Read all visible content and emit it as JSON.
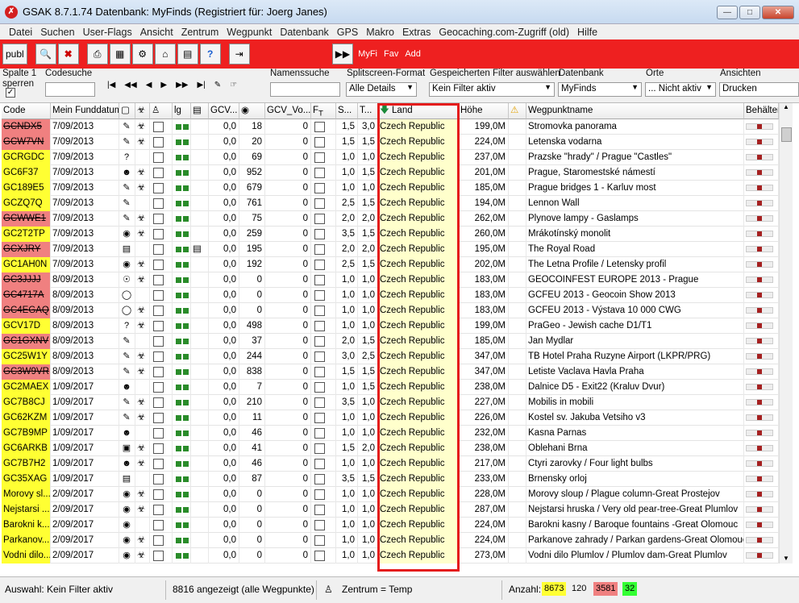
{
  "window": {
    "title": "GSAK 8.7.1.74    Datenbank: MyFinds    (Registriert für: Joerg Janes)"
  },
  "menu": [
    "Datei",
    "Suchen",
    "User-Flags",
    "Ansicht",
    "Zentrum",
    "Wegpunkt",
    "Datenbank",
    "GPS",
    "Makro",
    "Extras",
    "Geocaching.com-Zugriff (old)",
    "Hilfe"
  ],
  "toolbar": {
    "publ": "publ",
    "myfi": "MyFi",
    "fav": "Fav",
    "add": "Add"
  },
  "filterbar": {
    "spalte": "Spalte 1",
    "sperren": "sperren",
    "codesuche": "Codesuche",
    "namenssuche": "Namenssuche",
    "splitscreen_label": "Splitscreen-Format",
    "splitscreen_value": "Alle Details",
    "filter_label": "Gespeicherten Filter auswählen",
    "filter_value": "Kein Filter aktiv",
    "datenbank_label": "Datenbank",
    "datenbank_value": "MyFinds",
    "orte_label": "Orte",
    "orte_value": "... Nicht aktiv",
    "ansichten_label": "Ansichten",
    "ansichten_value": "Drucken"
  },
  "columns": [
    "Code",
    "Mein Funddatum",
    "",
    "",
    "",
    "lg",
    "",
    "GCV...",
    "",
    "GCV_Vo...",
    "",
    "S...",
    "T...",
    "Land",
    "Höhe",
    "",
    "Wegpunktname",
    "Behälter"
  ],
  "rows": [
    {
      "code": "GCNDX5",
      "cs": "r",
      "date": "7/09/2013",
      "gcv": "0,0",
      "fav": "18",
      "gcvvo": "0",
      "s": "1,5",
      "t": "3,0",
      "land": "Czech Republic",
      "hoehe": "199,0M",
      "name": "Stromovka panorama"
    },
    {
      "code": "GCW7VN",
      "cs": "r",
      "date": "7/09/2013",
      "gcv": "0,0",
      "fav": "20",
      "gcvvo": "0",
      "s": "1,5",
      "t": "1,5",
      "land": "Czech Republic",
      "hoehe": "224,0M",
      "name": "Letenska vodarna"
    },
    {
      "code": "GCRGDC",
      "cs": "y",
      "date": "7/09/2013",
      "gcv": "0,0",
      "fav": "69",
      "gcvvo": "0",
      "s": "1,0",
      "t": "1,0",
      "land": "Czech Republic",
      "hoehe": "237,0M",
      "name": "Prazske \"hrady\" / Prague \"Castles\""
    },
    {
      "code": "GC6F37",
      "cs": "y",
      "date": "7/09/2013",
      "gcv": "0,0",
      "fav": "952",
      "gcvvo": "0",
      "s": "1,0",
      "t": "1,5",
      "land": "Czech Republic",
      "hoehe": "201,0M",
      "name": "Prague, Staromestské námestí"
    },
    {
      "code": "GC189E5",
      "cs": "y",
      "date": "7/09/2013",
      "gcv": "0,0",
      "fav": "679",
      "gcvvo": "0",
      "s": "1,0",
      "t": "1,0",
      "land": "Czech Republic",
      "hoehe": "185,0M",
      "name": "Prague bridges 1 - Karluv most"
    },
    {
      "code": "GCZQ7Q",
      "cs": "y",
      "date": "7/09/2013",
      "gcv": "0,0",
      "fav": "761",
      "gcvvo": "0",
      "s": "2,5",
      "t": "1,5",
      "land": "Czech Republic",
      "hoehe": "194,0M",
      "name": "Lennon Wall"
    },
    {
      "code": "GCWWE1",
      "cs": "r",
      "date": "7/09/2013",
      "gcv": "0,0",
      "fav": "75",
      "gcvvo": "0",
      "s": "2,0",
      "t": "2,0",
      "land": "Czech Republic",
      "hoehe": "262,0M",
      "name": "Plynove lampy - Gaslamps"
    },
    {
      "code": "GC2T2TP",
      "cs": "y",
      "date": "7/09/2013",
      "gcv": "0,0",
      "fav": "259",
      "gcvvo": "0",
      "s": "3,5",
      "t": "1,5",
      "land": "Czech Republic",
      "hoehe": "260,0M",
      "name": "Mrákotínský monolit"
    },
    {
      "code": "GCXJRY",
      "cs": "r",
      "date": "7/09/2013",
      "gcv": "0,0",
      "fav": "195",
      "gcvvo": "0",
      "s": "2,0",
      "t": "2,0",
      "land": "Czech Republic",
      "hoehe": "195,0M",
      "name": "The Royal Road"
    },
    {
      "code": "GC1AH0N",
      "cs": "y",
      "date": "7/09/2013",
      "gcv": "0,0",
      "fav": "192",
      "gcvvo": "0",
      "s": "2,5",
      "t": "1,5",
      "land": "Czech Republic",
      "hoehe": "202,0M",
      "name": "The Letna Profile / Letensky profil"
    },
    {
      "code": "GC3JJJJ",
      "cs": "r",
      "date": "8/09/2013",
      "gcv": "0,0",
      "fav": "0",
      "gcvvo": "0",
      "s": "1,0",
      "t": "1,0",
      "land": "Czech Republic",
      "hoehe": "183,0M",
      "name": "GEOCOINFEST EUROPE 2013 - Prague"
    },
    {
      "code": "GC4717A",
      "cs": "r",
      "date": "8/09/2013",
      "gcv": "0,0",
      "fav": "0",
      "gcvvo": "0",
      "s": "1,0",
      "t": "1,0",
      "land": "Czech Republic",
      "hoehe": "183,0M",
      "name": "GCFEU 2013 - Geocoin Show 2013"
    },
    {
      "code": "GC4EGAQ",
      "cs": "r",
      "date": "8/09/2013",
      "gcv": "0,0",
      "fav": "0",
      "gcvvo": "0",
      "s": "1,0",
      "t": "1,0",
      "land": "Czech Republic",
      "hoehe": "183,0M",
      "name": "GCFEU 2013 - Výstava 10 000 CWG"
    },
    {
      "code": "GCV17D",
      "cs": "y",
      "date": "8/09/2013",
      "gcv": "0,0",
      "fav": "498",
      "gcvvo": "0",
      "s": "1,0",
      "t": "1,0",
      "land": "Czech Republic",
      "hoehe": "199,0M",
      "name": "PraGeo - Jewish cache D1/T1"
    },
    {
      "code": "GC1GXNV",
      "cs": "r",
      "date": "8/09/2013",
      "gcv": "0,0",
      "fav": "37",
      "gcvvo": "0",
      "s": "2,0",
      "t": "1,5",
      "land": "Czech Republic",
      "hoehe": "185,0M",
      "name": "Jan Mydlar"
    },
    {
      "code": "GC25W1Y",
      "cs": "y",
      "date": "8/09/2013",
      "gcv": "0,0",
      "fav": "244",
      "gcvvo": "0",
      "s": "3,0",
      "t": "2,5",
      "land": "Czech Republic",
      "hoehe": "347,0M",
      "name": "TB Hotel Praha Ruzyne Airport (LKPR/PRG)"
    },
    {
      "code": "GC3W9VR",
      "cs": "r",
      "date": "8/09/2013",
      "gcv": "0,0",
      "fav": "838",
      "gcvvo": "0",
      "s": "1,5",
      "t": "1,5",
      "land": "Czech Republic",
      "hoehe": "347,0M",
      "name": "Letiste Vaclava Havla Praha"
    },
    {
      "code": "GC2MAEX",
      "cs": "y",
      "date": "1/09/2017",
      "gcv": "0,0",
      "fav": "7",
      "gcvvo": "0",
      "s": "1,0",
      "t": "1,5",
      "land": "Czech Republic",
      "hoehe": "238,0M",
      "name": "Dalnice D5 - Exit22 (Kraluv Dvur)"
    },
    {
      "code": "GC7B8CJ",
      "cs": "y",
      "date": "1/09/2017",
      "gcv": "0,0",
      "fav": "210",
      "gcvvo": "0",
      "s": "3,5",
      "t": "1,0",
      "land": "Czech Republic",
      "hoehe": "227,0M",
      "name": "Mobilis in mobili"
    },
    {
      "code": "GC62KZM",
      "cs": "y",
      "date": "1/09/2017",
      "gcv": "0,0",
      "fav": "11",
      "gcvvo": "0",
      "s": "1,0",
      "t": "1,0",
      "land": "Czech Republic",
      "hoehe": "226,0M",
      "name": "Kostel sv. Jakuba Vetsiho v3"
    },
    {
      "code": "GC7B9MP",
      "cs": "y",
      "date": "1/09/2017",
      "gcv": "0,0",
      "fav": "46",
      "gcvvo": "0",
      "s": "1,0",
      "t": "1,0",
      "land": "Czech Republic",
      "hoehe": "232,0M",
      "name": "Kasna Parnas"
    },
    {
      "code": "GC6ARKB",
      "cs": "y",
      "date": "1/09/2017",
      "gcv": "0,0",
      "fav": "41",
      "gcvvo": "0",
      "s": "1,5",
      "t": "2,0",
      "land": "Czech Republic",
      "hoehe": "238,0M",
      "name": "Oblehani Brna"
    },
    {
      "code": "GC7B7H2",
      "cs": "y",
      "date": "1/09/2017",
      "gcv": "0,0",
      "fav": "46",
      "gcvvo": "0",
      "s": "1,0",
      "t": "1,0",
      "land": "Czech Republic",
      "hoehe": "217,0M",
      "name": "Ctyri zarovky / Four light bulbs"
    },
    {
      "code": "GC35XAG",
      "cs": "y",
      "date": "1/09/2017",
      "gcv": "0,0",
      "fav": "87",
      "gcvvo": "0",
      "s": "3,5",
      "t": "1,5",
      "land": "Czech Republic",
      "hoehe": "233,0M",
      "name": "Brnensky orloj"
    },
    {
      "code": "Morovy sl...",
      "cs": "y",
      "date": "2/09/2017",
      "gcv": "0,0",
      "fav": "0",
      "gcvvo": "0",
      "s": "1,0",
      "t": "1,0",
      "land": "Czech Republic",
      "hoehe": "228,0M",
      "name": "Morovy sloup / Plague column-Great Prostejov"
    },
    {
      "code": "Nejstarsi ...",
      "cs": "y",
      "date": "2/09/2017",
      "gcv": "0,0",
      "fav": "0",
      "gcvvo": "0",
      "s": "1,0",
      "t": "1,0",
      "land": "Czech Republic",
      "hoehe": "287,0M",
      "name": "Nejstarsi hruska / Very old pear-tree-Great Plumlov"
    },
    {
      "code": "Barokni k...",
      "cs": "y",
      "date": "2/09/2017",
      "gcv": "0,0",
      "fav": "0",
      "gcvvo": "0",
      "s": "1,0",
      "t": "1,0",
      "land": "Czech Republic",
      "hoehe": "224,0M",
      "name": "Barokni kasny / Baroque fountains -Great Olomouc"
    },
    {
      "code": "Parkanov...",
      "cs": "y",
      "date": "2/09/2017",
      "gcv": "0,0",
      "fav": "0",
      "gcvvo": "0",
      "s": "1,0",
      "t": "1,0",
      "land": "Czech Republic",
      "hoehe": "224,0M",
      "name": "Parkanove zahrady / Parkan gardens-Great Olomouc"
    },
    {
      "code": "Vodni dilo...",
      "cs": "y",
      "date": "2/09/2017",
      "gcv": "0,0",
      "fav": "0",
      "gcvvo": "0",
      "s": "1,0",
      "t": "1,0",
      "land": "Czech Republic",
      "hoehe": "273,0M",
      "name": "Vodni dilo Plumlov / Plumlov dam-Great Plumlov"
    }
  ],
  "status": {
    "auswahl": "Auswahl: Kein Filter aktiv",
    "angezeigt": "8816 angezeigt (alle Wegpunkte)",
    "zentrum": "Zentrum = Temp",
    "anzahl": "Anzahl:",
    "c1": "8673",
    "c2": "120",
    "c3": "3581",
    "c4": "32"
  },
  "colors": {
    "toolbar": "#ee2020",
    "highlight": "#e41c1c",
    "code_yellow": "#ffff33",
    "code_red": "#f08080",
    "land_bg": "#ffffcc"
  }
}
